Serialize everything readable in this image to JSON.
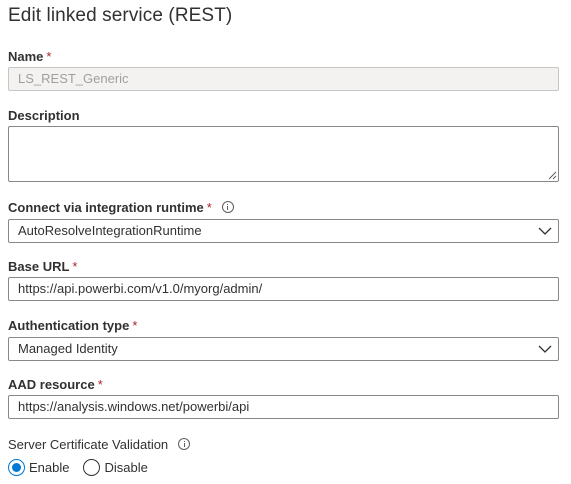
{
  "dialog": {
    "title": "Edit linked service (REST)"
  },
  "fields": {
    "name": {
      "label": "Name",
      "required": "*",
      "value": "LS_REST_Generic"
    },
    "description": {
      "label": "Description",
      "value": ""
    },
    "runtime": {
      "label": "Connect via integration runtime",
      "required": "*",
      "value": "AutoResolveIntegrationRuntime"
    },
    "base_url": {
      "label": "Base URL",
      "required": "*",
      "value": "https://api.powerbi.com/v1.0/myorg/admin/"
    },
    "auth_type": {
      "label": "Authentication type",
      "required": "*",
      "value": "Managed Identity"
    },
    "aad_resource": {
      "label": "AAD resource",
      "required": "*",
      "value": "https://analysis.windows.net/powerbi/api"
    }
  },
  "cert_validation": {
    "label": "Server Certificate Validation",
    "options": [
      {
        "label": "Enable",
        "selected": true
      },
      {
        "label": "Disable",
        "selected": false
      }
    ]
  },
  "colors": {
    "accent": "#0078d4",
    "required": "#a4262c",
    "text": "#323130",
    "border": "#8a8886"
  },
  "icons": [
    "info-icon",
    "chevron-down-icon",
    "resize-grip-icon",
    "radio-icon"
  ]
}
